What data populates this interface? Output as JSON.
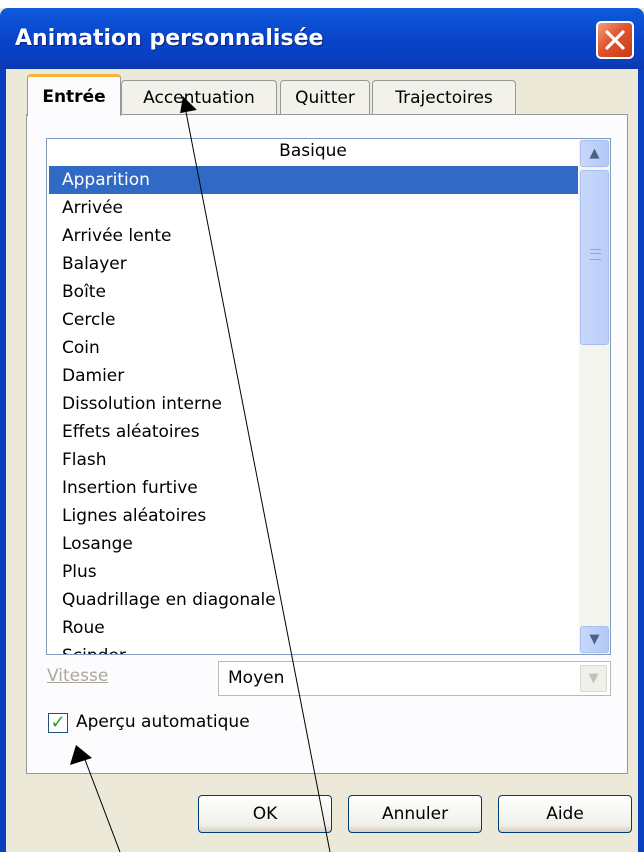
{
  "window": {
    "title": "Animation personnalisée"
  },
  "tabs": [
    {
      "label": "Entrée",
      "active": true
    },
    {
      "label": "Accentuation",
      "active": false
    },
    {
      "label": "Quitter",
      "active": false
    },
    {
      "label": "Trajectoires",
      "active": false
    }
  ],
  "effect_list": {
    "header": "Basique",
    "selected": "Apparition",
    "items": [
      "Apparition",
      "Arrivée",
      "Arrivée lente",
      "Balayer",
      "Boîte",
      "Cercle",
      "Coin",
      "Damier",
      "Dissolution interne",
      "Effets aléatoires",
      "Flash",
      "Insertion furtive",
      "Lignes aléatoires",
      "Losange",
      "Plus",
      "Quadrillage en diagonale",
      "Roue",
      "Scinder"
    ]
  },
  "speed": {
    "label": "Vitesse",
    "value": "Moyen"
  },
  "autopreview": {
    "label": "Aperçu automatique",
    "checked": true
  },
  "buttons": {
    "ok": "OK",
    "cancel": "Annuler",
    "help": "Aide"
  },
  "colors": {
    "titlebar": "#0a4fd0",
    "selection": "#316ac5",
    "active_tab_accent": "#f8b33c"
  }
}
